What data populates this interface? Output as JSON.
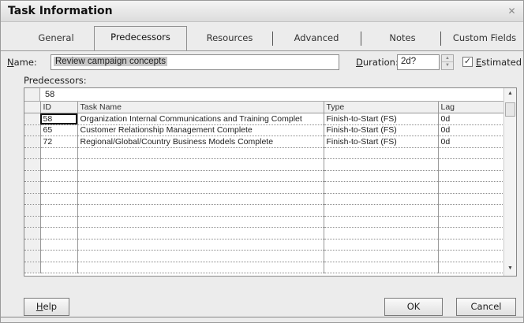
{
  "window": {
    "title": "Task Information",
    "close_glyph": "✕"
  },
  "tabs": [
    {
      "label": "General",
      "active": false
    },
    {
      "label": "Predecessors",
      "active": true
    },
    {
      "label": "Resources",
      "active": false
    },
    {
      "label": "Advanced",
      "active": false
    },
    {
      "label": "Notes",
      "active": false
    },
    {
      "label": "Custom Fields",
      "active": false
    }
  ],
  "form": {
    "name_label_prefix": "N",
    "name_label_rest": "ame:",
    "name_value": "Review campaign concepts",
    "duration_label_prefix": "D",
    "duration_label_rest": "uration:",
    "duration_value": "2d?",
    "estimated_checked": true,
    "estimated_check_glyph": "✓",
    "estimated_label_prefix": "E",
    "estimated_label_rest": "stimated"
  },
  "predecessors": {
    "label": "Predecessors:",
    "edit_value": "58",
    "columns": [
      "ID",
      "Task Name",
      "Type",
      "Lag"
    ],
    "rows": [
      {
        "id": "58",
        "name": "Organization Internal Communications and Training Complet",
        "type": "Finish-to-Start (FS)",
        "lag": "0d"
      },
      {
        "id": "65",
        "name": "Customer Relationship Management Complete",
        "type": "Finish-to-Start (FS)",
        "lag": "0d"
      },
      {
        "id": "72",
        "name": "Regional/Global/Country Business Models Complete",
        "type": "Finish-to-Start (FS)",
        "lag": "0d"
      },
      {
        "id": "",
        "name": "",
        "type": "",
        "lag": ""
      },
      {
        "id": "",
        "name": "",
        "type": "",
        "lag": ""
      },
      {
        "id": "",
        "name": "",
        "type": "",
        "lag": ""
      },
      {
        "id": "",
        "name": "",
        "type": "",
        "lag": ""
      },
      {
        "id": "",
        "name": "",
        "type": "",
        "lag": ""
      },
      {
        "id": "",
        "name": "",
        "type": "",
        "lag": ""
      },
      {
        "id": "",
        "name": "",
        "type": "",
        "lag": ""
      },
      {
        "id": "",
        "name": "",
        "type": "",
        "lag": ""
      },
      {
        "id": "",
        "name": "",
        "type": "",
        "lag": ""
      },
      {
        "id": "",
        "name": "",
        "type": "",
        "lag": ""
      },
      {
        "id": "",
        "name": "",
        "type": "",
        "lag": ""
      }
    ],
    "scroll_up_glyph": "▲",
    "scroll_down_glyph": "▼"
  },
  "spinner": {
    "up_glyph": "▲",
    "down_glyph": "▼"
  },
  "buttons": {
    "help_prefix": "H",
    "help_rest": "elp",
    "ok": "OK",
    "cancel": "Cancel"
  }
}
